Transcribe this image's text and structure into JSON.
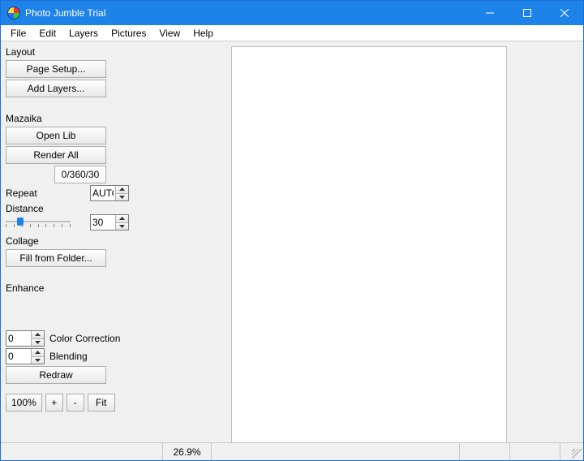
{
  "window": {
    "title": "Photo Jumble Trial"
  },
  "menu": {
    "file": "File",
    "edit": "Edit",
    "layers": "Layers",
    "pictures": "Pictures",
    "view": "View",
    "help": "Help"
  },
  "layout": {
    "heading": "Layout",
    "page_setup": "Page Setup...",
    "add_layers": "Add Layers..."
  },
  "mazaika": {
    "heading": "Mazaika",
    "open_lib": "Open Lib",
    "render_all": "Render All",
    "progress": "0/360/30",
    "repeat_label": "Repeat",
    "repeat_value": "AUTO",
    "distance_label": "Distance",
    "distance_value": "30"
  },
  "collage": {
    "heading": "Collage",
    "fill": "Fill from Folder..."
  },
  "enhance": {
    "heading": "Enhance",
    "color_value": "0",
    "color_label": "Color Correction",
    "blend_value": "0",
    "blend_label": "Blending",
    "redraw": "Redraw"
  },
  "zoom": {
    "pct": "100%",
    "plus": "+",
    "minus": "-",
    "fit": "Fit"
  },
  "status": {
    "progress_pct": "26.9%"
  }
}
